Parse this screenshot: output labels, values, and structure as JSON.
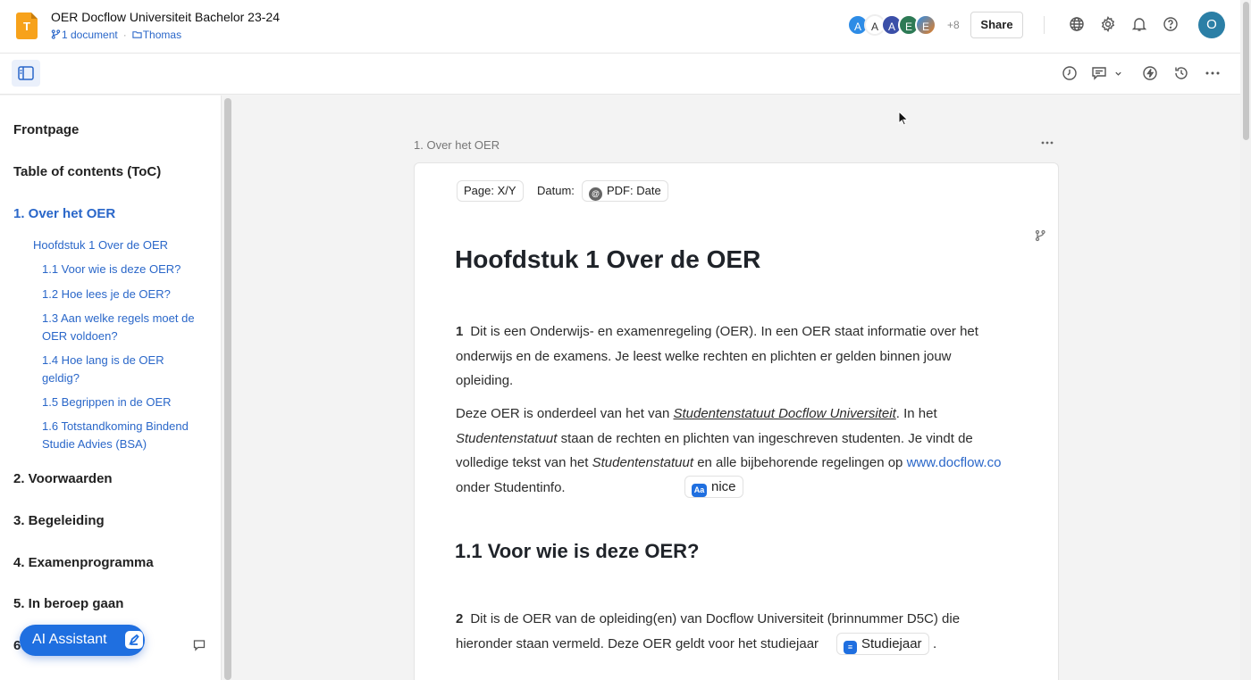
{
  "header": {
    "doc_icon_letter": "T",
    "title": "OER Docflow Universiteit Bachelor 23-24",
    "documents": "1 document",
    "folder": "Thomas",
    "avatars": [
      {
        "letter": "A",
        "color": "#2e8ce6"
      },
      {
        "letter": "A",
        "color": "#ffffff"
      },
      {
        "letter": "A",
        "color": "#3b4fa8"
      },
      {
        "letter": "E",
        "color": "#2d7a55"
      },
      {
        "letter": "E",
        "color": "#e67e22"
      }
    ],
    "avatars_more": "+8",
    "share_label": "Share",
    "user_initial": "O"
  },
  "sidebar": {
    "frontpage": "Frontpage",
    "toc": "Table of contents (ToC)",
    "section1": "1. Over het OER",
    "sub_heading": "Hoofdstuk 1 Over de OER",
    "items": [
      "1.1 Voor wie is deze OER?",
      "1.2 Hoe lees je de OER?",
      "1.3 Aan welke regels moet de OER voldoen?",
      "1.4 Hoe lang is de OER geldig?",
      "1.5 Begrippen in de OER",
      "1.6 Totstandkoming Bindend Studie Advies (BSA)"
    ],
    "section2": "2. Voorwaarden",
    "section3": "3. Begeleiding",
    "section4": "4. Examenprogramma",
    "section5": "5. In beroep gaan",
    "section6": "6",
    "ai_label": "AI Assistant"
  },
  "main": {
    "section_label": "1. Over het OER",
    "page_chip": "Page: X/Y",
    "datum_label": "Datum:",
    "pdf_chip": "PDF: Date",
    "h1": "Hoofdstuk 1  Over de OER",
    "p1_num": "1",
    "p1": "Dit is een Onderwijs- en examenregeling (OER). In een OER staat informatie over het onderwijs en de examens. Je leest welke rechten en plichten er gelden binnen jouw opleiding.",
    "p2_a": "Deze OER is onderdeel van het van ",
    "p2_link": "Studentenstatuut Docflow Universiteit",
    "p2_b": ". In het ",
    "p2_c": "Studentenstatuut",
    "p2_d": " staan de rechten en plichten van ingeschreven studenten. Je vindt de volledige tekst van het ",
    "p2_e": "Studentenstatuut",
    "p2_f": " en alle bijbehorende regelingen op ",
    "p2_url": "www.docflow.co",
    "p2_g": " onder Studentinfo.",
    "nice_chip": "nice",
    "h2": "1.1  Voor wie is deze OER?",
    "p3_num": "2",
    "p3": "Dit is de OER van de opleiding(en) van Docflow Universiteit (brinnummer D5C) die hieronder staan vermeld. Deze OER geldt voor het studiejaar",
    "studiejaar_chip": "Studiejaar",
    "p3_end": "."
  },
  "colors": {
    "accent": "#2a67c9",
    "ai_button": "#1f6fe0",
    "doc_icon": "#f7a21b"
  }
}
